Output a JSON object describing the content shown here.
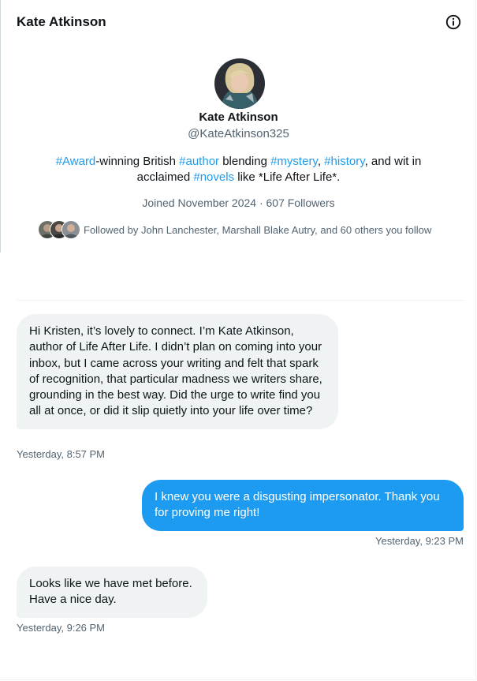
{
  "header": {
    "title": "Kate Atkinson",
    "info_icon": "info-circle-icon"
  },
  "profile": {
    "name": "Kate Atkinson",
    "handle": "@KateAtkinson325",
    "bio": {
      "tag1": "#Award",
      "text1": "-winning British ",
      "tag2": "#author",
      "text2": " blending ",
      "tag3": "#mystery",
      "text3": ", ",
      "tag4": "#history",
      "text4": ", and wit in acclaimed ",
      "tag5": "#novels",
      "text5": " like *Life After Life*."
    },
    "meta": "Joined November 2024 · 607 Followers",
    "followed_by": "Followed by John Lanchester, Marshall Blake Autry, and 60 others you follow"
  },
  "messages": [
    {
      "text": "Hi Kristen, it’s lovely to connect. I’m Kate Atkinson, author of Life After Life. I didn’t plan on coming into your inbox, but I came across your writing and felt that spark of recognition, that particular madness we writers share, grounding in the best way. Did the urge to write find you all at once, or did it slip quietly into your life over time?",
      "time": "Yesterday, 8:57 PM"
    },
    {
      "text": "I knew you were a disgusting impersonator. Thank you for proving me right!",
      "time": "Yesterday, 9:23 PM"
    },
    {
      "text": "Looks like we have met before. Have a nice day.",
      "time": "Yesterday, 9:26 PM"
    }
  ],
  "colors": {
    "accent": "#1d9bf0",
    "bubble_in": "#eff3f4",
    "muted": "#536471"
  }
}
